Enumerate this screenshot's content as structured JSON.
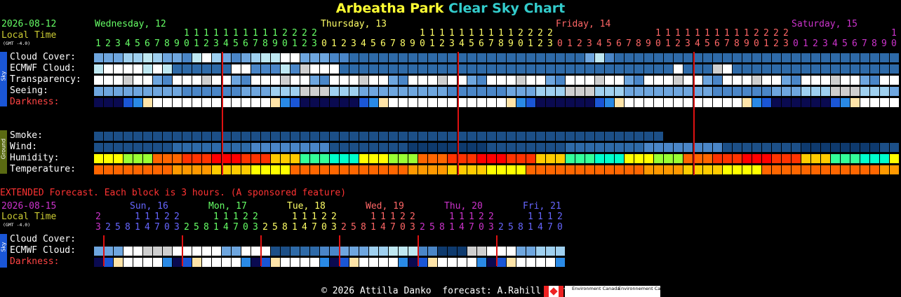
{
  "title": {
    "name": "Arbeatha Park",
    "suffix": "Clear Sky Chart",
    "name_color": "#ffff33",
    "suffix_color": "#33cccc"
  },
  "header": {
    "date": "2026-08-12",
    "local_time": "Local Time",
    "gmt": "(GMT -4.0)",
    "days": [
      {
        "label": "Wednesday, 12",
        "color": "#66ff66"
      },
      {
        "label": "Thursday, 13",
        "color": "#ffff66"
      },
      {
        "label": "Friday, 14",
        "color": "#ff6666"
      },
      {
        "label": "Saturday, 15",
        "color": "#cc33cc"
      }
    ]
  },
  "sky_rows": [
    "Cloud Cover:",
    "ECMWF Cloud:",
    "Transparency:",
    "Seeing:",
    "Darkness:"
  ],
  "ground_rows": [
    "Smoke:",
    "Wind:",
    "Humidity:",
    "Temperature:"
  ],
  "side_labels": {
    "sky": "Sky",
    "ground": "Ground"
  },
  "extended": {
    "note": "EXTENDED Forecast. Each block is 3 hours. (A sponsored feature)",
    "date": "2026-08-15",
    "local_time": "Local Time",
    "gmt": "(GMT -4.0)",
    "days": [
      {
        "label": "Sun, 16",
        "color": "#6666ff"
      },
      {
        "label": "Mon, 17",
        "color": "#66ff66"
      },
      {
        "label": "Tue, 18",
        "color": "#ffff66"
      },
      {
        "label": "Wed, 19",
        "color": "#ff6666"
      },
      {
        "label": "Thu, 20",
        "color": "#cc33cc"
      },
      {
        "label": "Fri, 21",
        "color": "#6666ff"
      }
    ],
    "rows": [
      "Cloud Cover:",
      "ECMWF Cloud:",
      "Darkness:"
    ]
  },
  "footer": {
    "text": "© 2026 Attilla Danko  forecast: A.Rahill  data:",
    "logo1": "Environment Canada",
    "logo2": "Environnement Canada"
  }
}
